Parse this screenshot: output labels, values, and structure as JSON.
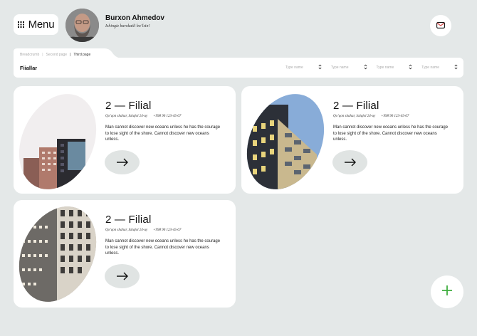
{
  "header": {
    "menu_label": "Menu",
    "user_name": "Burxon Ahmedov",
    "user_subtitle": "Ishingiz barokatli bo’lsin!"
  },
  "breadcrumbs": [
    "Breadcrumb",
    "Second page",
    "Third page"
  ],
  "page": {
    "title": "Fiiallar"
  },
  "filters": [
    {
      "label": "Type name"
    },
    {
      "label": "Type name"
    },
    {
      "label": "Type name"
    },
    {
      "label": "Type name"
    }
  ],
  "branches": [
    {
      "name": "2 — Filial",
      "address": "Qo’qon shahar, Istiqlol 24-uy",
      "phone": "+998 90 123-45-67",
      "description": "Man cannot discover new oceans unless he has the courage to lose sight of the shore. Cannot discover new oceans unless."
    },
    {
      "name": "2 — Filial",
      "address": "Qo’qon shahar, Istiqlol 24-uy",
      "phone": "+998 90 123-45-67",
      "description": "Man cannot discover new oceans unless he has the courage to lose sight of the shore. Cannot discover new oceans unless."
    },
    {
      "name": "2 — Filial",
      "address": "Qo’qon shahar, Istiqlol 24-uy",
      "phone": "+998 90 123-45-67",
      "description": "Man cannot discover new oceans unless he has the courage to lose sight of the shore. Cannot discover new oceans unless."
    }
  ],
  "icons": {
    "menu": "grid-icon",
    "mail": "mail-icon",
    "arrow": "arrow-right-icon",
    "add": "plus-icon",
    "chevron": "chevron-up-down-icon"
  },
  "colors": {
    "background": "#e4e8e8",
    "accent": "#3fae3f",
    "button_bg": "#e0e4e3",
    "mail_accent": "#d23a3a"
  }
}
